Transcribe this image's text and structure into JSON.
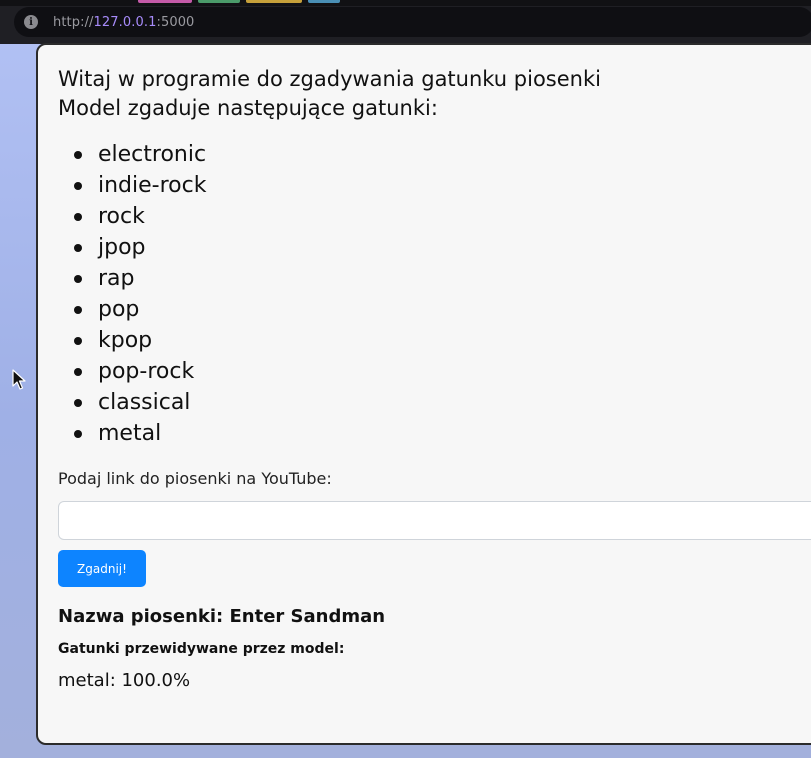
{
  "browser": {
    "url_scheme": "http://",
    "url_host": "127.0.0.1",
    "url_port": ":5000"
  },
  "page": {
    "intro_line1": "Witaj w programie do zgadywania gatunku piosenki",
    "intro_line2": "Model zgaduje następujące gatunki:",
    "genres": [
      "electronic",
      "indie-rock",
      "rock",
      "jpop",
      "rap",
      "pop",
      "kpop",
      "pop-rock",
      "classical",
      "metal"
    ],
    "link_label": "Podaj link do piosenki na YouTube:",
    "link_input_value": "",
    "guess_button_label": "Zgadnij!",
    "song_title": "Nazwa piosenki: Enter Sandman",
    "predictions_heading": "Gatunki przewidywane przez model:",
    "prediction": "metal: 100.0%"
  },
  "colors": {
    "button": "#0d84ff",
    "url_host": "#a78bfa",
    "card_background": "#f7f7f7"
  }
}
